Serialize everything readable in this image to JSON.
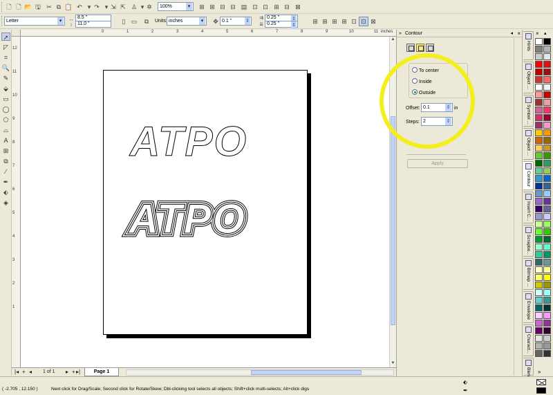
{
  "toolbar": {
    "zoom_value": "100%",
    "paper_size": "Letter",
    "width_value": "8.5 \"",
    "height_value": "11.0 \"",
    "units_label": "Units:",
    "units_value": "inches",
    "nudge_value": "0.1 \"",
    "dup_x_value": "0.25 \"",
    "dup_y_value": "0.25 \""
  },
  "ruler": {
    "h_ticks": [
      "0",
      "1",
      "2",
      "3",
      "4",
      "5",
      "6",
      "7",
      "8",
      "9",
      "10",
      "11"
    ],
    "units": "inches",
    "v_ticks": [
      "12",
      "11",
      "10",
      "9",
      "8",
      "7",
      "6",
      "5",
      "4",
      "3",
      "2",
      "1"
    ]
  },
  "canvas": {
    "text1": "ATPO",
    "text2": "ATPO"
  },
  "pagebar": {
    "page_counter": "1 of 1",
    "page_tab": "Page 1"
  },
  "docker": {
    "title": "Contour",
    "option_center": "To center",
    "option_inside": "Inside",
    "option_outside": "Outside",
    "selected_option": "Outside",
    "offset_label": "Offset:",
    "offset_value": "0.1",
    "offset_unit": "in",
    "steps_label": "Steps:",
    "steps_value": "2",
    "apply_label": "Apply"
  },
  "sidetabs": [
    {
      "label": "Hints"
    },
    {
      "label": "Object ..."
    },
    {
      "label": "Symbol ..."
    },
    {
      "label": "Object ..."
    },
    {
      "label": "Contour"
    },
    {
      "label": "Insert C..."
    },
    {
      "label": "Scrapbo..."
    },
    {
      "label": "Bitmap ..."
    },
    {
      "label": "Envelope"
    },
    {
      "label": "Charact..."
    },
    {
      "label": "Blend"
    }
  ],
  "palette_colors": [
    "#ffffff",
    "#000000",
    "#7f7f7f",
    "#b2b2b2",
    "#cccccc",
    "#e5e5e5",
    "#ff0000",
    "#e01010",
    "#c00000",
    "#a01010",
    "#cc3333",
    "#ff6666",
    "#ffffff",
    "#f2f2f2",
    "#ff9999",
    "#cc0000",
    "#993333",
    "#e8a0a0",
    "#cc6699",
    "#ff3366",
    "#cc3366",
    "#990033",
    "#993366",
    "#ff99cc",
    "#ffcc00",
    "#ff9900",
    "#cc6600",
    "#996600",
    "#ffcc66",
    "#cc9933",
    "#66cc33",
    "#339900",
    "#006600",
    "#339966",
    "#66cc99",
    "#99cc66",
    "#3399cc",
    "#0066cc",
    "#003399",
    "#336699",
    "#6699cc",
    "#99ccff",
    "#9966cc",
    "#663399",
    "#330066",
    "#666699",
    "#9999cc",
    "#ccccff",
    "#ccff99",
    "#99ff66",
    "#66ff33",
    "#33cc00",
    "#009933",
    "#006633",
    "#99ffcc",
    "#66ffcc",
    "#33cc99",
    "#009966",
    "#336666",
    "#669999",
    "#ffffcc",
    "#ffff99",
    "#ffff66",
    "#ffff00",
    "#cccc00",
    "#999900",
    "#ccffff",
    "#99ffff",
    "#66cccc",
    "#339999",
    "#006666",
    "#003333",
    "#ffccff",
    "#ff99ff",
    "#cc66cc",
    "#993399",
    "#660066",
    "#330033",
    "#e5e5e5",
    "#cccccc",
    "#b2b2b2",
    "#999999",
    "#666666",
    "#333333"
  ],
  "status": {
    "coords": "( -2.705 , 12.150 )",
    "hint": "Next click for Drag/Scale; Second click for Rotate/Skew; Dbl-clicking tool selects all objects; Shift+click multi-selects; Alt+click digs"
  },
  "icons": {
    "new": "new-document-icon",
    "open": "open-icon",
    "save": "save-icon",
    "print": "print-icon",
    "cut": "cut-icon",
    "copy": "copy-icon",
    "paste": "paste-icon",
    "undo": "undo-icon",
    "redo": "redo-icon",
    "import": "import-icon",
    "export": "export-icon",
    "launcher": "application-launcher-icon",
    "corel-online": "corel-online-icon",
    "pick": "pick-tool-icon",
    "shape": "shape-tool-icon",
    "crop": "crop-tool-icon",
    "zoom": "zoom-tool-icon",
    "freehand": "freehand-tool-icon",
    "smart-fill": "smart-fill-tool-icon",
    "rectangle": "rectangle-tool-icon",
    "ellipse": "ellipse-tool-icon",
    "polygon": "polygon-tool-icon",
    "basic-shapes": "basic-shapes-tool-icon",
    "text": "text-tool-icon",
    "interactive": "interactive-blend-tool-icon",
    "eyedropper": "eyedropper-tool-icon",
    "outline": "outline-tool-icon",
    "fill": "fill-tool-icon",
    "interactive-fill": "interactive-fill-tool-icon"
  }
}
